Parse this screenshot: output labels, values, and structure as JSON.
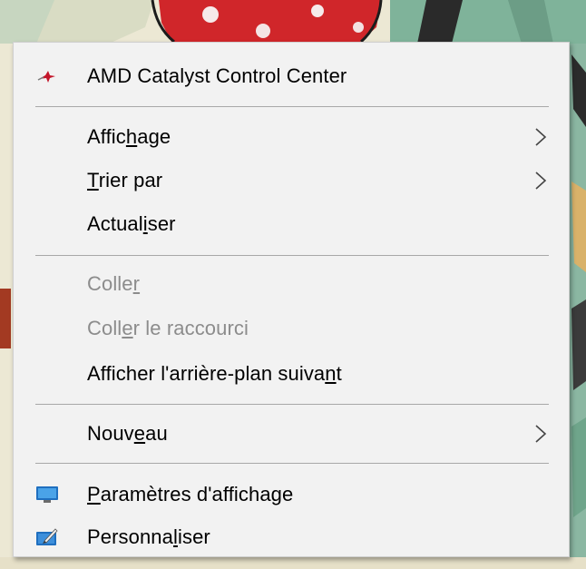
{
  "menu": {
    "items": [
      {
        "id": "amd",
        "label": "AMD Catalyst Control Center",
        "icon": "amd-icon",
        "submenu": false,
        "disabled": false
      },
      {
        "id": "affichage",
        "label_parts": [
          "Affic",
          "h",
          "age"
        ],
        "submenu": true,
        "disabled": false
      },
      {
        "id": "trier",
        "label_parts": [
          "",
          "T",
          "rier par"
        ],
        "submenu": true,
        "disabled": false
      },
      {
        "id": "actualiser",
        "label_parts": [
          "Actual",
          "i",
          "ser"
        ],
        "submenu": false,
        "disabled": false
      },
      {
        "id": "coller",
        "label_parts": [
          "Colle",
          "r",
          ""
        ],
        "submenu": false,
        "disabled": true
      },
      {
        "id": "coller-raccourci",
        "label_parts": [
          "Coll",
          "e",
          "r le raccourci"
        ],
        "submenu": false,
        "disabled": true
      },
      {
        "id": "arriere-plan",
        "label_parts": [
          "Afficher l'arrière-plan suiva",
          "n",
          "t"
        ],
        "submenu": false,
        "disabled": false
      },
      {
        "id": "nouveau",
        "label_parts": [
          "Nouv",
          "e",
          "au"
        ],
        "submenu": true,
        "disabled": false
      },
      {
        "id": "parametres",
        "label_parts": [
          "",
          "P",
          "aramètres d'affichage"
        ],
        "icon": "display-settings-icon",
        "submenu": false,
        "disabled": false
      },
      {
        "id": "personnaliser",
        "label_parts": [
          "Personna",
          "l",
          "iser"
        ],
        "icon": "personalize-icon",
        "submenu": false,
        "disabled": false
      }
    ]
  },
  "colors": {
    "menu_background": "#f2f2f2",
    "separator": "#a8a8a8",
    "disabled_text": "#8c8c8c",
    "text": "#000000"
  }
}
